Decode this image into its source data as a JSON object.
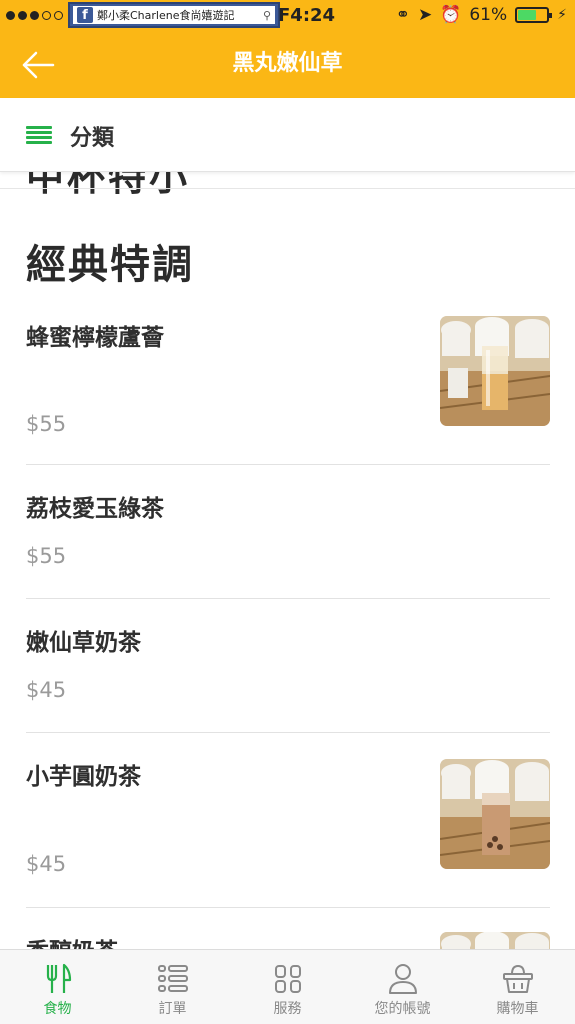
{
  "status_bar": {
    "time": "F4:24",
    "battery": "61%",
    "overlay_text": "鄭小柔Charlene食尚嬉遊記",
    "overlay_logo": "f"
  },
  "header": {
    "title": "黑丸嫩仙草",
    "color": "#fbb715"
  },
  "category_bar": {
    "label": "分類",
    "accent": "#26b14a"
  },
  "content": {
    "previous_section_title_cut": "中杯特小",
    "section_title": "經典特調",
    "items": [
      {
        "name": "蜂蜜檸檬蘆薈",
        "price": "$55",
        "has_image": true
      },
      {
        "name": "荔枝愛玉綠茶",
        "price": "$55",
        "has_image": false
      },
      {
        "name": "嫩仙草奶茶",
        "price": "$45",
        "has_image": false
      },
      {
        "name": "小芋圓奶茶",
        "price": "$45",
        "has_image": true
      },
      {
        "name": "香醇奶茶",
        "price": "",
        "has_image": true
      }
    ]
  },
  "tabbar": {
    "tabs": [
      {
        "label": "食物",
        "icon": "fork-knife-icon",
        "active": true
      },
      {
        "label": "訂單",
        "icon": "order-list-icon",
        "active": false
      },
      {
        "label": "服務",
        "icon": "service-grid-icon",
        "active": false
      },
      {
        "label": "您的帳號",
        "icon": "person-icon",
        "active": false
      },
      {
        "label": "購物車",
        "icon": "basket-icon",
        "active": false
      }
    ]
  }
}
